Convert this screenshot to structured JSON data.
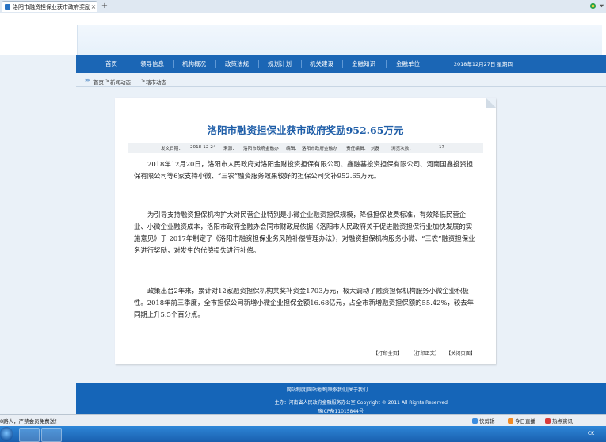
{
  "browser": {
    "tab_title": "洛阳市融资担保业获市政府奖励952.65万元",
    "tab_close": "×",
    "new_tab": "+"
  },
  "nav": {
    "items": [
      "首页",
      "领导信息",
      "机构概况",
      "政策法规",
      "规划计划",
      "机关建设",
      "金融知识",
      "金融单位"
    ],
    "date": "2018年12月27日 星期四"
  },
  "breadcrumb": {
    "arrow": "»»",
    "items": [
      "首页",
      "新闻动态",
      "辖市动态"
    ],
    "separator": ">"
  },
  "article": {
    "title": "洛阳市融资担保业获市政府奖励952.65万元",
    "meta": {
      "date_label": "发文日期：",
      "date": "2018-12-24",
      "source_label": "来源：",
      "source": "洛阳市政府金融办",
      "editor_label": "编辑：",
      "editor": "洛阳市政府金融办",
      "responsible_label": "责任编辑：",
      "responsible": "刘磊",
      "views_label": "浏览次数：",
      "views": "17"
    },
    "paragraphs": [
      "2018年12月20日，洛阳市人民政府对洛阳金财投资担保有限公司、鑫融基投资担保有限公司、河南国鑫投资担保有限公司等6家支持小微、“三农”融资服务效果较好的担保公司奖补952.65万元。",
      "为引导支持融资担保机构扩大对民营企业特别是小微企业融资担保规模，降低担保收费标准，有效降低民营企业、小微企业融资成本，洛阳市政府金融办会同市财政局依据《洛阳市人民政府关于促进融资担保行业加快发展的实施意见》于 2017年制定了《洛阳市融资担保业务风险补偿管理办法》，对融资担保机构服务小微、“三农”融资担保业务进行奖励，对发生的代偿损失进行补偿。",
      "政策出台2年来，累计对12家融资担保机构共奖补资金1703万元，极大调动了融资担保机构服务小微企业积极性。2018年前三季度，全市担保公司新增小微企业担保金额16.68亿元，占全市新增融资担保额的55.42%，较去年同期上升5.5个百分点。"
    ],
    "actions": [
      "【打印全页】",
      "【打印正文】",
      "【关闭页面】"
    ]
  },
  "footer": {
    "links": [
      "网站制度",
      "网站地图",
      "联系我们",
      "关于我们"
    ],
    "sponsor": "主办：河南省人民政府金融服务办公室 Copyright © 2011 All Rights Reserved",
    "icp": "豫ICP备11015844号"
  },
  "statusbar": {
    "left_text": "8路人，严禁会员免费送！",
    "items": [
      "快剪辑",
      "今日直播",
      "热点资讯"
    ]
  },
  "taskbar": {
    "tray_text": "CK"
  },
  "colors": {
    "nav_bg": "#1b66b5",
    "title": "#1f5ea8",
    "footer_bg": "#1565b8"
  }
}
